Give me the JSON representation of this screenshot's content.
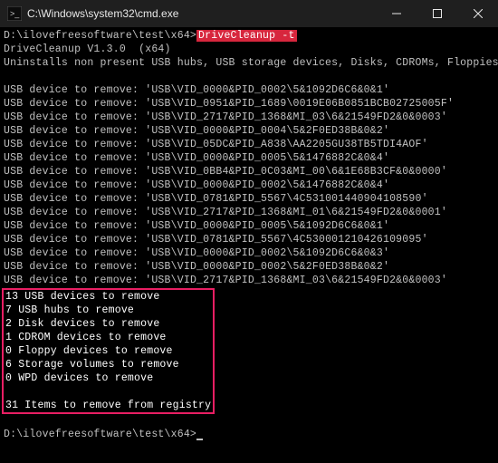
{
  "titlebar": {
    "icon_name": "cmd-icon",
    "title": "C:\\Windows\\system32\\cmd.exe"
  },
  "prompt": {
    "path": "D:\\ilovefreesoftware\\test\\x64>",
    "command": "DriveCleanup -t"
  },
  "header": {
    "line1": "DriveCleanup V1.3.0  (x64)",
    "line2": "Uninstalls non present USB hubs, USB storage devices, Disks, CDROMs, Floppies, Storage volumes and WPD devices"
  },
  "devices": [
    {
      "label": "USB device to remove:",
      "id": "'USB\\VID_0000&PID_0002\\5&1092D6C6&0&1'"
    },
    {
      "label": "USB device to remove:",
      "id": "'USB\\VID_0951&PID_1689\\0019E06B0851BCB02725005F'"
    },
    {
      "label": "USB device to remove:",
      "id": "'USB\\VID_2717&PID_1368&MI_03\\6&21549FD2&0&0003'"
    },
    {
      "label": "USB device to remove:",
      "id": "'USB\\VID_0000&PID_0004\\5&2F0ED38B&0&2'"
    },
    {
      "label": "USB device to remove:",
      "id": "'USB\\VID_05DC&PID_A838\\AA2205GU38TB5TDI4AOF'"
    },
    {
      "label": "USB device to remove:",
      "id": "'USB\\VID_0000&PID_0005\\5&1476882C&0&4'"
    },
    {
      "label": "USB device to remove:",
      "id": "'USB\\VID_0BB4&PID_0C03&MI_00\\6&1E68B3CF&0&0000'"
    },
    {
      "label": "USB device to remove:",
      "id": "'USB\\VID_0000&PID_0002\\5&1476882C&0&4'"
    },
    {
      "label": "USB device to remove:",
      "id": "'USB\\VID_0781&PID_5567\\4C531001440904108590'"
    },
    {
      "label": "USB device to remove:",
      "id": "'USB\\VID_2717&PID_1368&MI_01\\6&21549FD2&0&0001'"
    },
    {
      "label": "USB device to remove:",
      "id": "'USB\\VID_0000&PID_0005\\5&1092D6C6&0&1'"
    },
    {
      "label": "USB device to remove:",
      "id": "'USB\\VID_0781&PID_5567\\4C530001210426109095'"
    },
    {
      "label": "USB device to remove:",
      "id": "'USB\\VID_0000&PID_0002\\5&1092D6C6&0&3'"
    },
    {
      "label": "USB device to remove:",
      "id": "'USB\\VID_0000&PID_0002\\5&2F0ED38B&0&2'"
    },
    {
      "label": "USB device to remove:",
      "id": "'USB\\VID_2717&PID_1368&MI_03\\6&21549FD2&0&0003'"
    }
  ],
  "summary": [
    "13 USB devices to remove",
    "7 USB hubs to remove",
    "2 Disk devices to remove",
    "1 CDROM devices to remove",
    "0 Floppy devices to remove",
    "6 Storage volumes to remove",
    "0 WPD devices to remove",
    "",
    "31 Items to remove from registry"
  ],
  "prompt2": {
    "path": "D:\\ilovefreesoftware\\test\\x64>"
  }
}
